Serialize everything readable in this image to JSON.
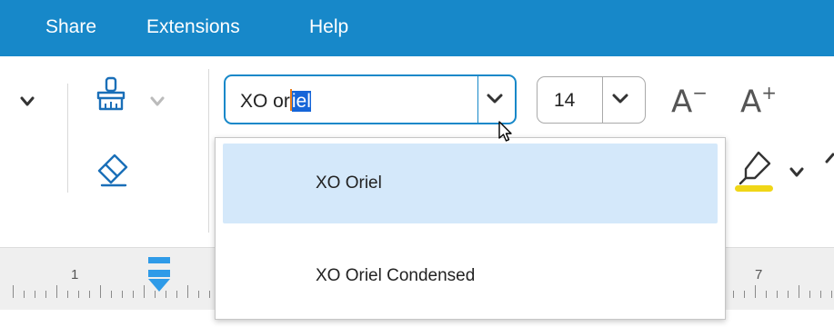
{
  "menu": {
    "items": [
      {
        "label": "Share"
      },
      {
        "label": "Extensions"
      },
      {
        "label": "Help"
      }
    ]
  },
  "font_picker": {
    "typed_prefix": "XO or",
    "autocomplete_selected": "iel"
  },
  "font_size": {
    "value": "14"
  },
  "font_dropdown": {
    "options": [
      {
        "label": "XO Oriel",
        "highlighted": true
      },
      {
        "label": "XO Oriel Condensed",
        "highlighted": false
      }
    ]
  },
  "ruler": {
    "labels": [
      "1",
      "7"
    ]
  },
  "colors": {
    "menubar": "#1788c9",
    "accent": "#1788c9",
    "highlight_option": "#d4e8fa",
    "highlighter_marker": "#f0d617",
    "ruler_marker": "#2f9be8"
  },
  "icons": [
    "chevron-down-icon",
    "paint-brush-icon",
    "eraser-icon",
    "decrease-font-size-icon",
    "increase-font-size-icon",
    "highlighter-icon",
    "tab-stop-marker-icon",
    "mouse-cursor-icon"
  ]
}
